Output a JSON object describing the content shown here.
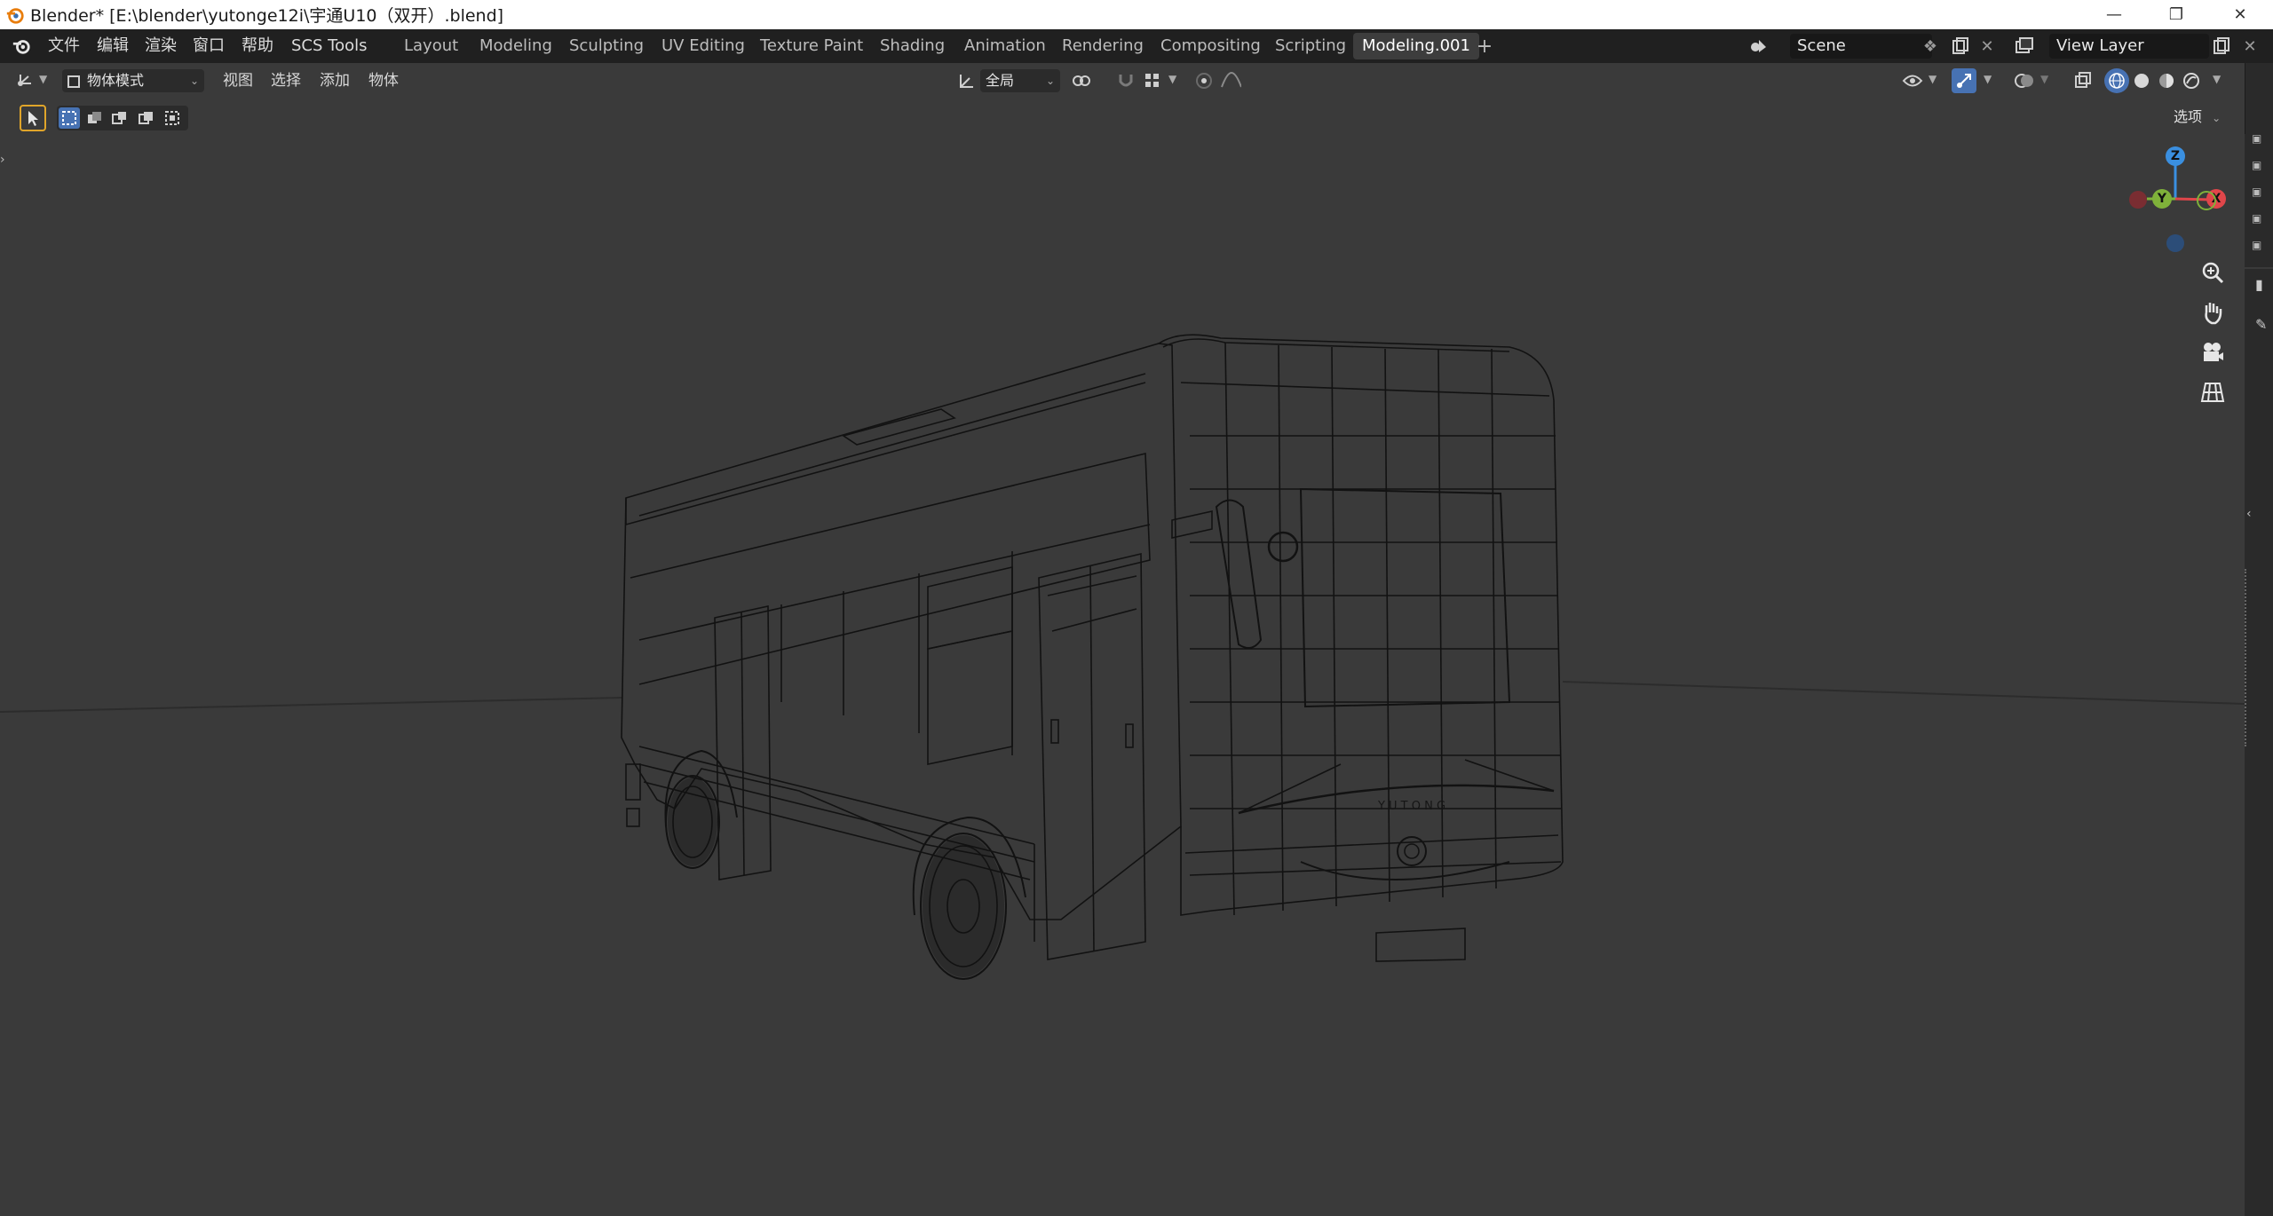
{
  "window": {
    "title": "Blender* [E:\\blender\\yutonge12i\\宇通U10（双开）.blend]"
  },
  "menu": {
    "items": [
      "文件",
      "编辑",
      "渲染",
      "窗口",
      "帮助",
      "SCS Tools"
    ]
  },
  "workspaces": {
    "tabs": [
      "Layout",
      "Modeling",
      "Sculpting",
      "UV Editing",
      "Texture Paint",
      "Shading",
      "Animation",
      "Rendering",
      "Compositing",
      "Scripting",
      "Modeling.001"
    ],
    "active": "Modeling.001"
  },
  "scene": {
    "label": "Scene"
  },
  "view_layer": {
    "label": "View Layer"
  },
  "viewport_header": {
    "mode": "物体模式",
    "menus": [
      "视图",
      "选择",
      "添加",
      "物体"
    ],
    "transform_orientation": "全局",
    "options_label": "选项"
  },
  "gizmo": {
    "z": "Z",
    "y": "Y",
    "x": "X"
  },
  "model": {
    "brand_text": "Y U T O N G"
  },
  "colors": {
    "accent_active": "#4772b3",
    "background": "#3a3a3a",
    "wire": "#0e0e0e",
    "gizmo_x": "#e0464a",
    "gizmo_y": "#7fb13a",
    "gizmo_z": "#3a8fe0"
  },
  "icons": [
    "blender-logo-icon",
    "minimize-icon",
    "restore-icon",
    "close-icon",
    "add-workspace-icon",
    "scene-icon",
    "pin-icon",
    "new-scene-icon",
    "remove-scene-icon",
    "view-layer-icon",
    "editor-type-icon",
    "object-mode-icon",
    "orientation-icon",
    "pivot-icon",
    "snap-icon",
    "snap-increment-icon",
    "proportional-icon",
    "falloff-icon",
    "visibility-icon",
    "gizmo-icon",
    "overlay-icon",
    "xray-icon",
    "wireframe-shading-icon",
    "solid-shading-icon",
    "material-shading-icon",
    "rendered-shading-icon",
    "select-tool-icon",
    "zoom-icon",
    "pan-icon",
    "camera-icon",
    "grid-view-icon"
  ]
}
